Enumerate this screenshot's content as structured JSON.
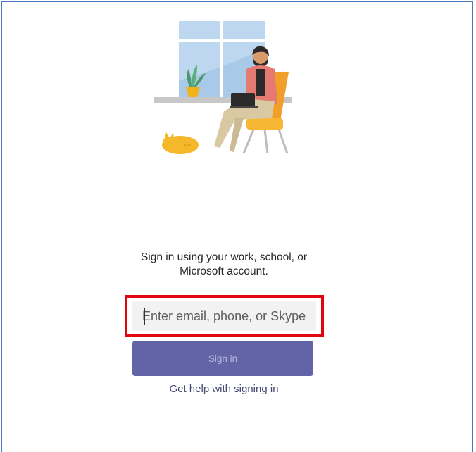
{
  "signin": {
    "prompt_line1": "Sign in using your work, school, or",
    "prompt_line2": "Microsoft account.",
    "email_placeholder": "Enter email, phone, or Skype",
    "email_value": "",
    "signin_button_label": "Sign in",
    "help_link_label": "Get help with signing in"
  },
  "colors": {
    "brand_purple": "#6264a7",
    "highlight_red": "#e0070e",
    "link_color": "#464775",
    "frame_blue": "#4a78c2"
  },
  "illustration": {
    "subject": "person-with-laptop-in-chair",
    "details": [
      "window",
      "potted-plant",
      "sleeping-cat",
      "shelf"
    ]
  }
}
